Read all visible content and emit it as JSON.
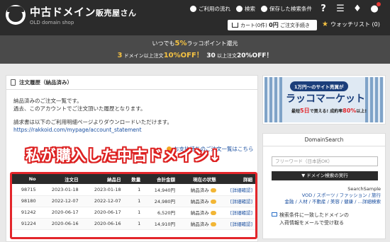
{
  "header": {
    "logo_title_main": "中古ドメイン",
    "logo_title_small": "販売屋さん",
    "logo_sub": "OLD domain shop",
    "nav": [
      {
        "label": "ご利用の流れ",
        "icon": "help-circle-icon"
      },
      {
        "label": "検索",
        "icon": "search-icon"
      },
      {
        "label": "保存した検索条件",
        "icon": "settings-icon"
      }
    ],
    "icons": [
      "question-icon",
      "menu-icon",
      "bell-icon",
      "user-icon"
    ],
    "cart": {
      "prefix": "カート",
      "count": "(0件)",
      "amount": "0円",
      "action": "ご注文手続き"
    },
    "watchlist": "ウォッチリスト (0)"
  },
  "promo": {
    "line1_pre": "いつでも",
    "line1_hl": "5%",
    "line1_post": "ラッコポイント還元",
    "line2_a_num": "3",
    "line2_a_text": "ドメイン以上注文",
    "line2_a_hl": "10%OFF！",
    "line2_b_num": "30",
    "line2_b_text": "以上注文",
    "line2_b_hl": "20%OFF！"
  },
  "main": {
    "title": "注文履歴（納品済み）",
    "p1": "納品済みのご注文一覧です。",
    "p2": "過去、このアカウントでご注文頂いた履歴となります。",
    "p3": "請求書は以下のご利用明細ページよりダウンロードいただけます。",
    "url": "https://rakkoid.com/mypage/account_statement",
    "pay_link": "お支払待ちのご注文一覧はこちら",
    "banner": "私が購入した中古ドメイン↓",
    "table": {
      "headers": [
        "No",
        "注文日",
        "納品日",
        "数量",
        "合計金額",
        "現在の状態",
        "詳細"
      ],
      "rows": [
        {
          "no": "98715",
          "order": "2023-01-18",
          "deliver": "2023-01-18",
          "qty": "1",
          "total": "14,940円",
          "status": "納品済み",
          "detail": "[詳細確認]"
        },
        {
          "no": "98180",
          "order": "2022-12-07",
          "deliver": "2022-12-07",
          "qty": "1",
          "total": "24,980円",
          "status": "納品済み",
          "detail": "[詳細確認]"
        },
        {
          "no": "91242",
          "order": "2020-06-17",
          "deliver": "2020-06-17",
          "qty": "1",
          "total": "6,520円",
          "status": "納品済み",
          "detail": "[詳細確認]"
        },
        {
          "no": "91224",
          "order": "2020-06-16",
          "deliver": "2020-06-16",
          "qty": "1",
          "total": "14,910円",
          "status": "納品済み",
          "detail": "[詳細確認]"
        }
      ]
    }
  },
  "sidebar": {
    "ad_pill": "1万円〜のサイト売買が",
    "ad_title": "ラッコマーケット",
    "ad_sub_pre": "最短",
    "ad_sub_hl": "5日",
    "ad_sub_mid": "で買える! 成約率",
    "ad_sub_hl2": "80%",
    "ad_sub_post": "以上!",
    "search_title": "DomainSearch",
    "search_placeholder": "フリーワード（日本語OK）",
    "search_button": "ドメイン検索の実行",
    "sample_label": "SearchSample",
    "sample_line1": "VOD / スポーツ / ファッション / 旅行",
    "sample_line2": "金融 / 人材 / 不動産 / 美容 / 健康 / …詳細検索",
    "mail_line1": "検索条件に一致したドメインの",
    "mail_line2": "入荷情報をメールで受け取る"
  }
}
